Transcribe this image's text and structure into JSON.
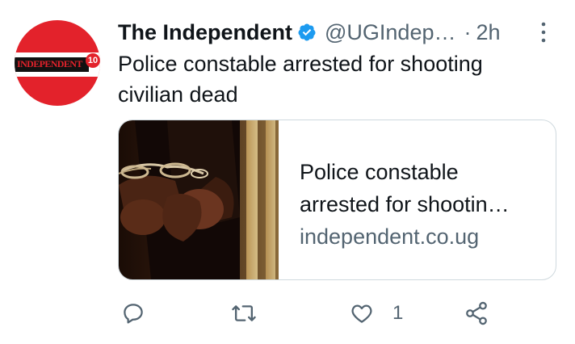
{
  "tweet": {
    "author_name": "The Independent",
    "handle": "@UGIndep…",
    "separator": "·",
    "time": "2h",
    "text": "Police constable arrested for shooting civilian dead",
    "avatar": {
      "logo_text": "INDEPENDENT",
      "logo_badge": "10"
    },
    "card": {
      "title": "Police constable arrested for shootin…",
      "domain": "independent.co.ug"
    },
    "actions": {
      "reply_count": "",
      "retweet_count": "",
      "like_count": "1"
    }
  },
  "colors": {
    "text_primary": "#0f1419",
    "text_secondary": "#536471",
    "verified_blue": "#1d9bf0",
    "card_border": "#cfd9de",
    "brand_red": "#e3222b"
  },
  "icons": {
    "verified": "verified-badge-icon",
    "more": "more-vertical-icon",
    "reply": "reply-icon",
    "retweet": "retweet-icon",
    "like": "heart-icon",
    "share": "share-icon"
  }
}
